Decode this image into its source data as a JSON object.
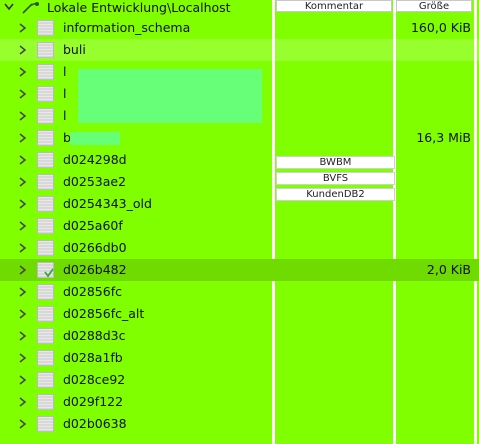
{
  "tree": {
    "root_label": "Lokale Entwicklung\\Localhost",
    "databases": [
      {
        "name": "information_schema",
        "size": "160,0 KiB"
      },
      {
        "name": "buli",
        "size": ""
      },
      {
        "name": "l",
        "size": ""
      },
      {
        "name": "l",
        "size": ""
      },
      {
        "name": "l",
        "size": ""
      },
      {
        "name": "b",
        "size": "16,3 MiB"
      },
      {
        "name": "d024298d",
        "size": ""
      },
      {
        "name": "d0253ae2",
        "size": ""
      },
      {
        "name": "d0254343_old",
        "size": ""
      },
      {
        "name": "d025a60f",
        "size": ""
      },
      {
        "name": "d0266db0",
        "size": ""
      },
      {
        "name": "d026b482",
        "size": "2,0 KiB"
      },
      {
        "name": "d02856fc",
        "size": ""
      },
      {
        "name": "d02856fc_alt",
        "size": ""
      },
      {
        "name": "d0288d3c",
        "size": ""
      },
      {
        "name": "d028a1fb",
        "size": ""
      },
      {
        "name": "d028ce92",
        "size": ""
      },
      {
        "name": "d029f122",
        "size": ""
      },
      {
        "name": "d02b0638",
        "size": ""
      }
    ]
  },
  "columns": {
    "comment": "Kommentar",
    "size": "Größe"
  },
  "comments": [
    "BWBM",
    "BVFS",
    "KundenDB2"
  ],
  "colors": {
    "background": "#80ff00",
    "selected_row": "#6fdb00",
    "redaction": "#66ff77"
  },
  "icons": {
    "expanded": "chevron-down-icon",
    "collapsed": "chevron-right-icon",
    "server": "server-connection-icon",
    "database": "database-icon",
    "check": "check-icon"
  }
}
